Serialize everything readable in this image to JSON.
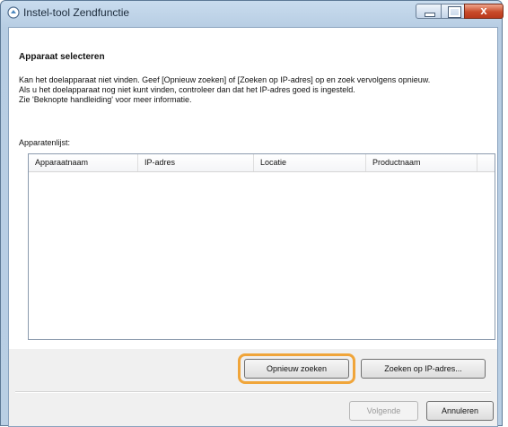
{
  "window": {
    "title": "Instel-tool Zendfunctie",
    "close_glyph": "x"
  },
  "main": {
    "heading": "Apparaat selecteren",
    "description": "Kan het doelapparaat niet vinden. Geef [Opnieuw zoeken] of [Zoeken op IP-adres] op en zoek vervolgens opnieuw.\nAls u het doelapparaat nog niet kunt vinden, controleer dan dat het IP-adres goed is ingesteld.\nZie 'Beknopte handleiding' voor meer informatie.",
    "list_label": "Apparatenlijst:",
    "columns": [
      "Apparaatnaam",
      "IP-adres",
      "Locatie",
      "Productnaam"
    ],
    "rows": []
  },
  "buttons": {
    "search_again": "Opnieuw zoeken",
    "search_ip": "Zoeken op IP-adres...",
    "next": "Volgende",
    "cancel": "Annuleren"
  },
  "colors": {
    "focus_highlight": "#f0a53a",
    "close_button": "#c84b2a"
  }
}
